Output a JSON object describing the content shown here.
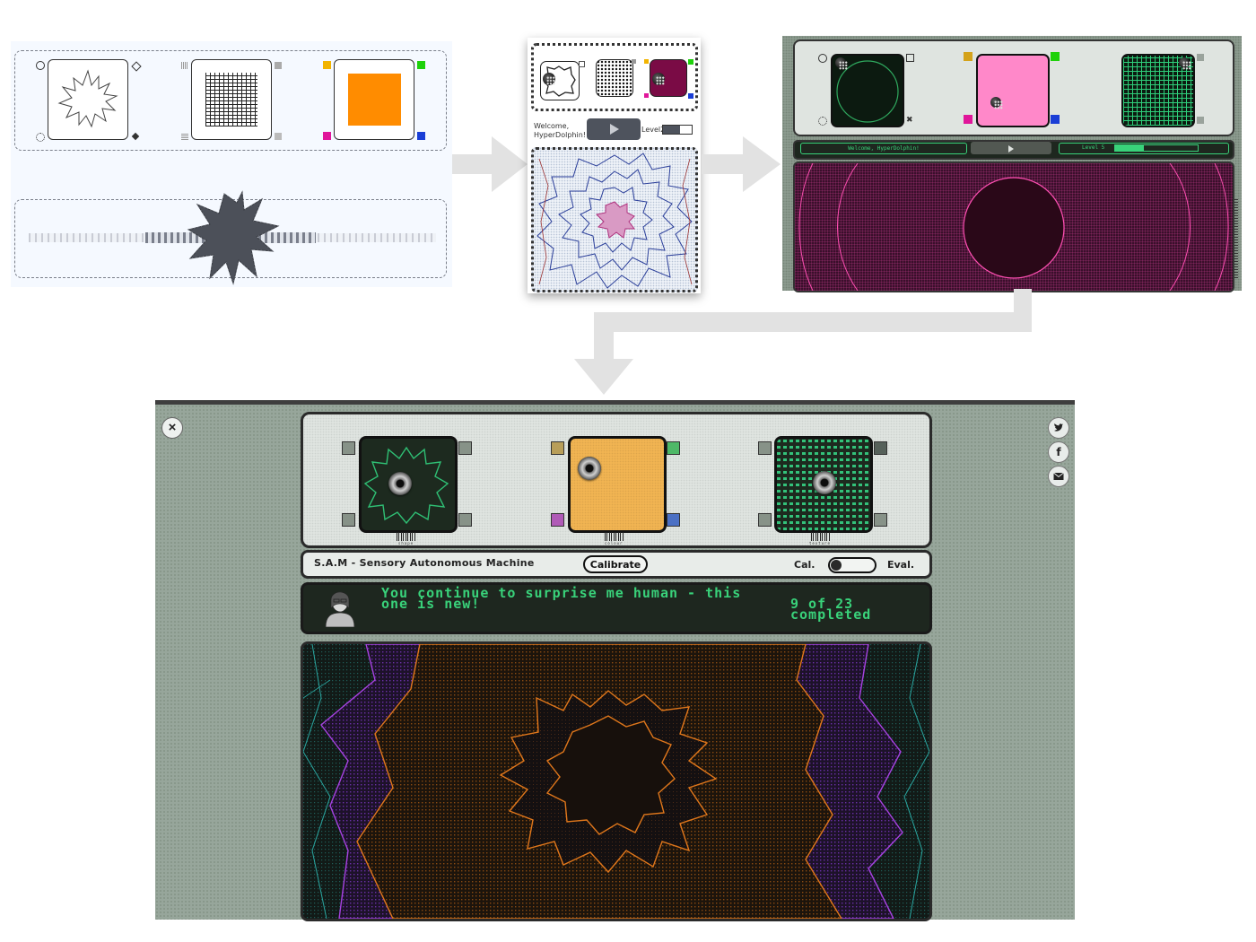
{
  "stage2": {
    "welcome": "Welcome,\nHyperDolphin!",
    "level": "Level2"
  },
  "stage3": {
    "welcome": "Welcome, HyperDolphin!",
    "level": "Level 5"
  },
  "final": {
    "title": "S.A.M - Sensory Autonomous Machine",
    "calibrate_label": "Calibrate",
    "toggle_left": "Cal.",
    "toggle_right": "Eval.",
    "message": "You continue to surprise me human - this one is new!",
    "progress": "9 of 23 completed",
    "progress_fraction": 0.391,
    "barcodes": [
      "shape",
      "colour",
      "texture"
    ],
    "social": [
      "twitter-icon",
      "facebook-icon",
      "email-icon"
    ],
    "close_glyph": "×"
  },
  "colors": {
    "orange": "#ff8c00",
    "pink": "#ff88c9",
    "maroon": "#7a0b45",
    "final_colour_box": "#f1b452",
    "terminal_green": "#39d27a",
    "flow_arrow": "#e2e2e2"
  }
}
